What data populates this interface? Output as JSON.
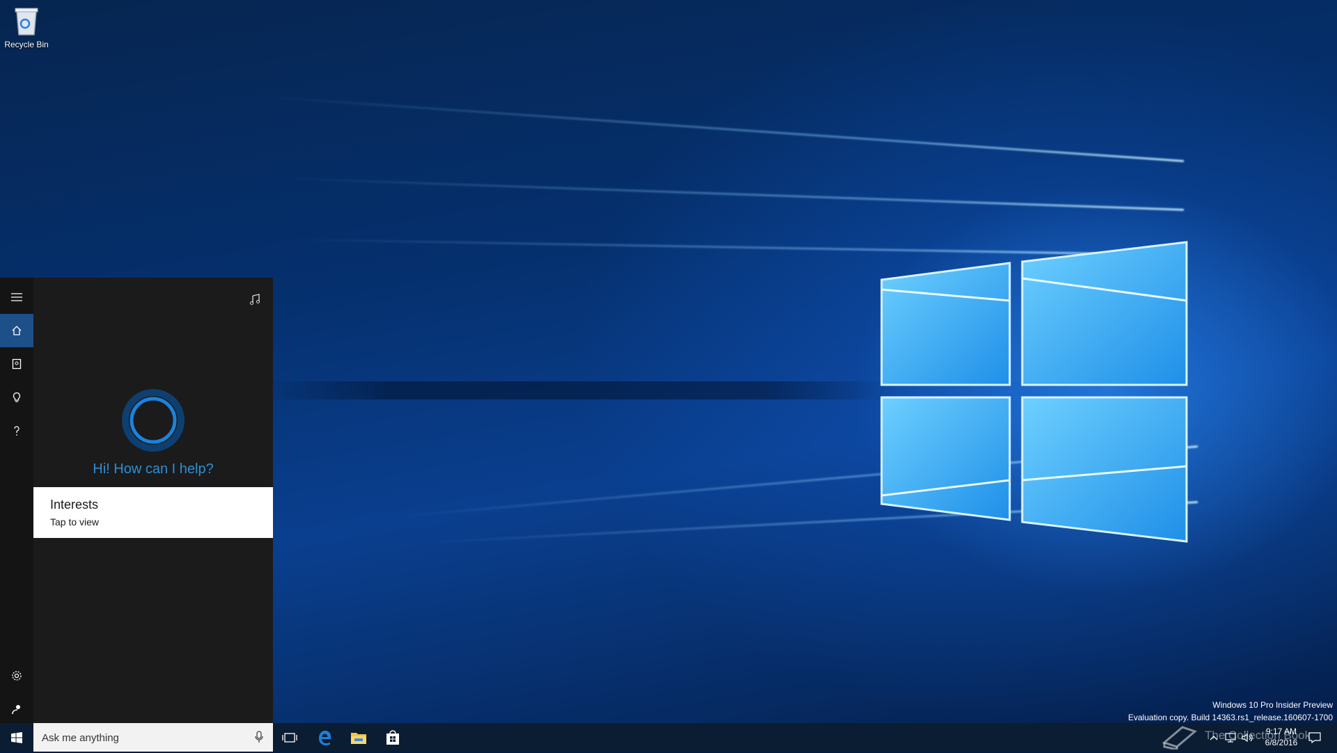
{
  "desktop": {
    "icons": [
      {
        "label": "Recycle Bin",
        "icon": "recycle-bin-icon"
      }
    ]
  },
  "cortana": {
    "rail": [
      "menu-icon",
      "home-icon",
      "notebook-icon",
      "lightbulb-icon",
      "help-icon",
      "settings-icon",
      "feedback-icon"
    ],
    "greeting": "Hi! How can I help?",
    "card": {
      "title": "Interests",
      "subtitle": "Tap to view"
    },
    "accent": "#2b8fd6",
    "active_rail_color": "#1d4f88"
  },
  "taskbar": {
    "search_placeholder": "Ask me anything",
    "pinned": [
      "task-view-icon",
      "edge-icon",
      "file-explorer-icon",
      "store-icon"
    ],
    "clock": {
      "time": "9:17 AM",
      "date": "6/8/2016"
    }
  },
  "watermark": {
    "line1": "Windows 10 Pro Insider Preview",
    "line2": "Evaluation copy. Build 14363.rs1_release.160607-1700",
    "overlay": "The Collection Book"
  }
}
